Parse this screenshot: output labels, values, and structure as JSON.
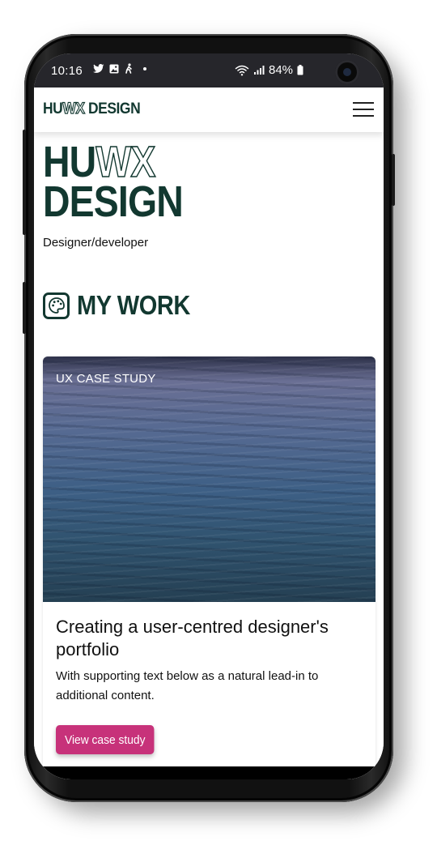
{
  "status_bar": {
    "time": "10:16",
    "battery": "84%",
    "icons": [
      "twitter-icon",
      "image-icon",
      "accessibility-icon",
      "dot-icon",
      "wifi-icon",
      "signal-icon",
      "battery-icon"
    ]
  },
  "navbar": {
    "brand_solid": "HU",
    "brand_outline": "WX",
    "brand_rest": " DESIGN",
    "menu_icon": "hamburger-icon"
  },
  "hero": {
    "line1_solid": "HU",
    "line1_outline": "WX",
    "line2": "DESIGN",
    "tagline": "Designer/developer"
  },
  "section": {
    "icon": "palette-icon",
    "title": "MY WORK"
  },
  "card": {
    "label": "UX CASE STUDY",
    "title": "Creating a user-centred designer's portfolio",
    "text": "With supporting text below as a natural lead-in to additional content.",
    "button_label": "View case study",
    "button_color": "#c7327a"
  },
  "colors": {
    "brand": "#123830",
    "status_bar": "#26262b"
  }
}
